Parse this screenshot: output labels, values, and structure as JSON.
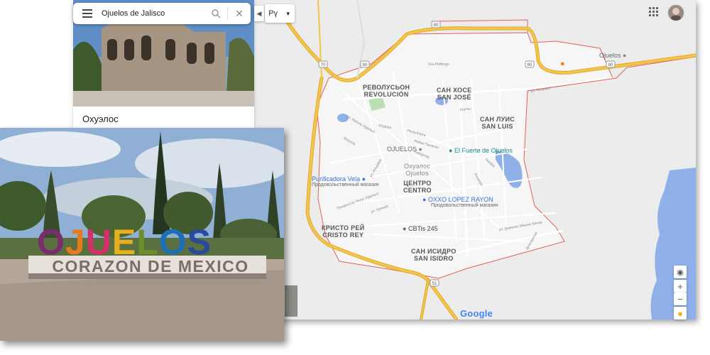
{
  "search": {
    "query": "Ojuelos de Jalisco"
  },
  "layer_label": "Рү",
  "place_card": {
    "title": "Охуэлос"
  },
  "map": {
    "colors": {
      "road_major": "#f3c64a",
      "road_casing": "#e2a92d",
      "boundary": "#e06060",
      "water": "#8fb0e8",
      "urban": "#f4f4f4",
      "park": "#b9dfb2"
    },
    "districts": [
      {
        "name": "РЕВОЛУСЬОН",
        "sub": "REVOLUCIÓN"
      },
      {
        "name": "САН ХОСЕ",
        "sub": "SAN JOSÉ"
      },
      {
        "name": "САН ЛУИС",
        "sub": "SAN LUIS"
      },
      {
        "name": "ЦЕНТРО",
        "sub": "CENTRO"
      },
      {
        "name": "КРИСТО РЕЙ",
        "sub": "CRISTO REY"
      },
      {
        "name": "САН ИСИДРО",
        "sub": "SAN ISIDRO"
      }
    ],
    "town_label": {
      "name": "Охуэлос",
      "sub": "Ojuelos"
    },
    "pois": [
      {
        "name": "OJUELOS",
        "icon": "place-pin-icon"
      },
      {
        "name": "El Fuerte de Ojuelos",
        "icon": "landmark-pin-icon"
      },
      {
        "name": "Purificadora Vela",
        "sub": "Продовольственный магазин",
        "icon": "shopping-pin-icon"
      },
      {
        "name": "OXXO LOPEZ RAYON",
        "sub": "Продовольственный магазин",
        "icon": "shopping-pin-icon"
      },
      {
        "name": "CBTis 245",
        "icon": "school-pin-icon"
      },
      {
        "name": "Ojuelos",
        "icon": "place-pin-icon"
      }
    ],
    "route_shields": [
      "80",
      "70",
      "80",
      "80",
      "80",
      "51"
    ],
    "streets": [
      "Хоэ Роблсдо",
      "ул. Мигель Идальго",
      "Кортес",
      "ул. Позуэро",
      "Мадеро",
      "Республика",
      "Рейна Паласио",
      "Либертад",
      "Чиуауа",
      "Альвару",
      "ул. Альдама",
      "Профессор Хесус Идальго",
      "ул. Аранда",
      "ул. Доминго Маскас Бачар",
      "Демократия",
      "Эскуэла"
    ],
    "attribution": "Google"
  },
  "photo": {
    "sign_letters": [
      "O",
      "J",
      "U",
      "E",
      "L",
      "O",
      "S"
    ],
    "sign_colors": [
      "#7a2d6e",
      "#e57b1c",
      "#d42f6c",
      "#e8b01e",
      "#6a8f2b",
      "#1d6fb5",
      "#274b9a"
    ],
    "caption": "CORAZON DE MEXICO"
  }
}
